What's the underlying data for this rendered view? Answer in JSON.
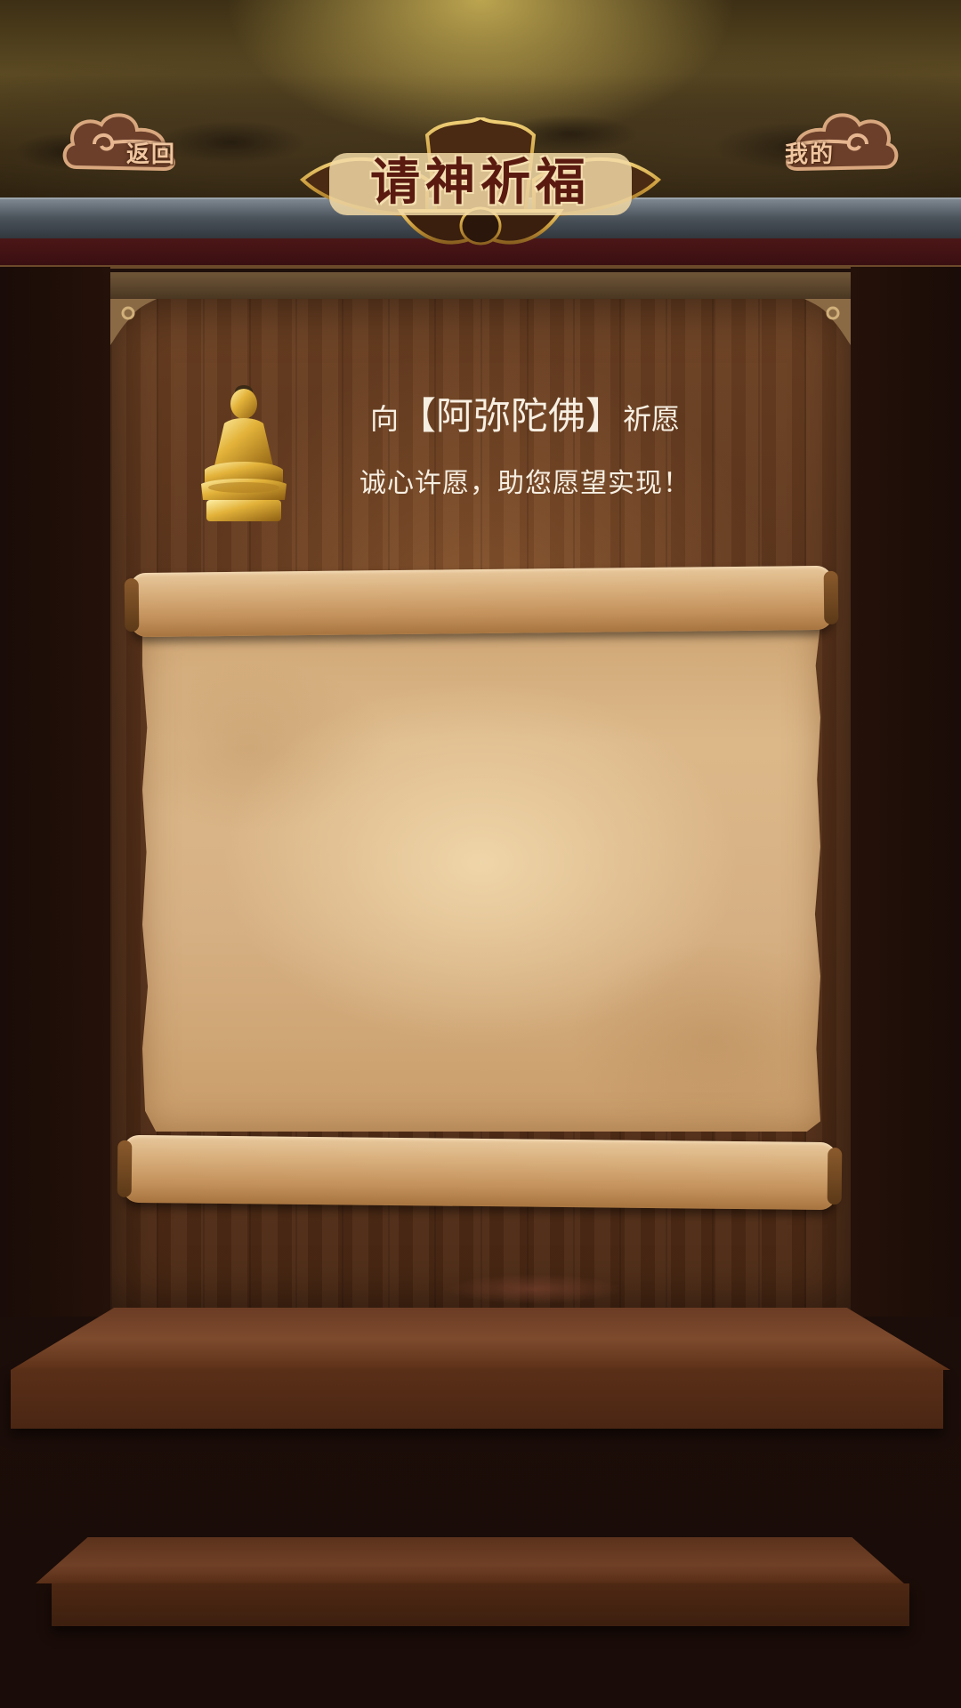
{
  "header": {
    "title": "请神祈福",
    "back_label": "返回",
    "mine_label": "我的"
  },
  "prayer": {
    "prefix": "向",
    "open_bracket": "【",
    "deity": "阿弥陀佛",
    "close_bracket": "】",
    "suffix": "祈愿",
    "subtitle": "诚心许愿，助您愿望实现！"
  },
  "colors": {
    "gold": "#d8a93a",
    "wood": "#5a331b",
    "parchment": "#d9b586",
    "text_light": "#f7efe2"
  }
}
